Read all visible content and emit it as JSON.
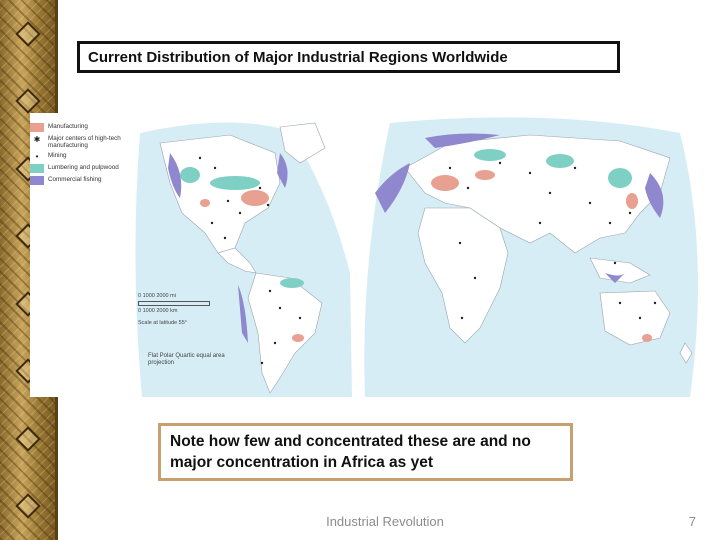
{
  "slide": {
    "title": "Current Distribution of Major Industrial Regions Worldwide",
    "note": "Note how few and concentrated these are and no major concentration in Africa as yet",
    "footer": "Industrial Revolution",
    "page_number": "7"
  },
  "map": {
    "legend": [
      {
        "label": "Manufacturing",
        "kind": "swatch",
        "color": "#e8a090"
      },
      {
        "label": "Major centers of high-tech manufacturing",
        "kind": "dot",
        "color": "#222222"
      },
      {
        "label": "Mining",
        "kind": "dot",
        "color": "#222222"
      },
      {
        "label": "Lumbering and pulpwood",
        "kind": "swatch",
        "color": "#7fd0c4"
      },
      {
        "label": "Commercial fishing",
        "kind": "swatch",
        "color": "#8f88cf"
      }
    ],
    "scale_values": "0   1000   2000 mi",
    "scale_values_km": "0   1000   2000 km",
    "scale_caption": "Scale at latitude 55°",
    "projection": "Flat Polar Quartic equal area projection",
    "colors": {
      "ocean": "#d6edf6",
      "land": "#ffffff",
      "border": "#9aa4a8",
      "manufacturing": "#e8a090",
      "lumbering": "#7fd0c4",
      "fishing": "#8f88cf"
    }
  }
}
